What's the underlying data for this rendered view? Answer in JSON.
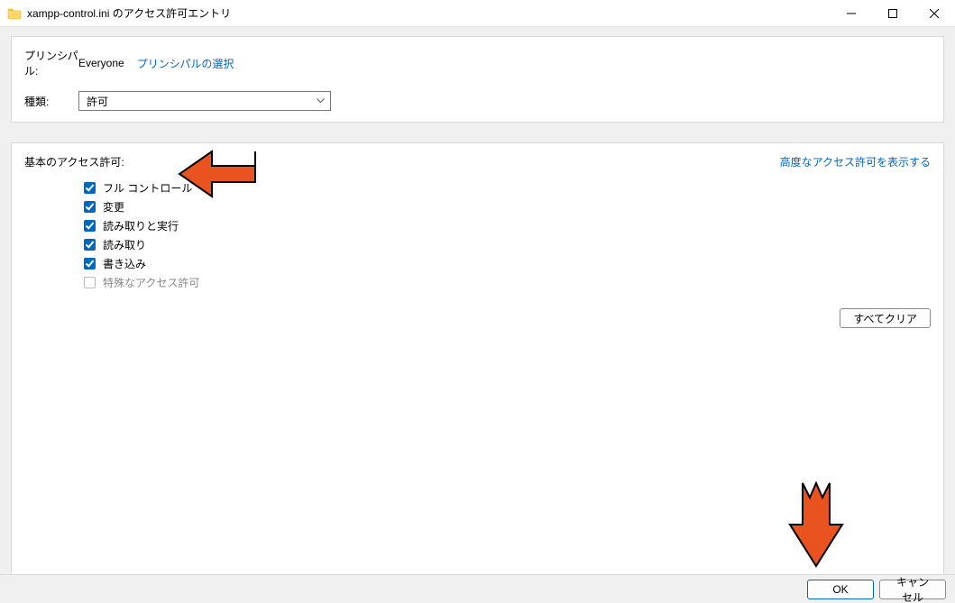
{
  "window": {
    "title": "xampp-control.ini のアクセス許可エントリ"
  },
  "principal": {
    "label": "プリンシパル:",
    "value": "Everyone",
    "select_link": "プリンシパルの選択"
  },
  "type": {
    "label": "種類:",
    "value": "許可"
  },
  "permissions": {
    "header": "基本のアクセス許可:",
    "advanced_link": "高度なアクセス許可を表示する",
    "items": [
      {
        "label": "フル コントロール",
        "checked": true,
        "disabled": false
      },
      {
        "label": "変更",
        "checked": true,
        "disabled": false
      },
      {
        "label": "読み取りと実行",
        "checked": true,
        "disabled": false
      },
      {
        "label": "読み取り",
        "checked": true,
        "disabled": false
      },
      {
        "label": "書き込み",
        "checked": true,
        "disabled": false
      },
      {
        "label": "特殊なアクセス許可",
        "checked": false,
        "disabled": true
      }
    ],
    "clear_all": "すべてクリア"
  },
  "footer": {
    "ok": "OK",
    "cancel": "キャンセル"
  },
  "colors": {
    "link": "#0066cc",
    "accent": "#0067c0",
    "arrow": "#e8531f"
  }
}
